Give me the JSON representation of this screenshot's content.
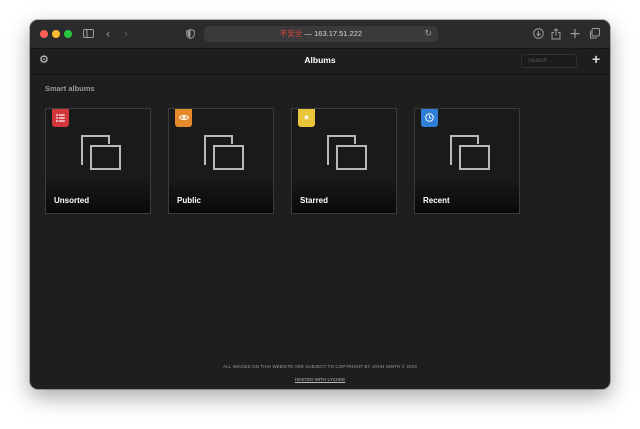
{
  "browser": {
    "url_warning": "不安全",
    "url_separator": "—",
    "url_host": "163.17.51.222",
    "icons": {
      "sidebar": "sidebar-icon",
      "back": "chevron-left-icon",
      "forward": "chevron-right-icon",
      "privacy": "shield-icon",
      "reload": "reload-icon",
      "download": "download-icon",
      "share": "share-icon",
      "new_tab": "plus-icon",
      "tabs": "tab-overview-icon"
    },
    "traffic_colors": [
      "#fe5f57",
      "#febc2e",
      "#28c840"
    ]
  },
  "header": {
    "title": "Albums",
    "search_placeholder": "Search …",
    "settings_icon": "gear-icon",
    "add_icon": "plus-icon"
  },
  "smart_albums": {
    "heading": "Smart albums",
    "items": [
      {
        "label": "Unsorted",
        "icon": "list-icon",
        "color": "#d0363a"
      },
      {
        "label": "Public",
        "icon": "eye-icon",
        "color": "#e58a2a"
      },
      {
        "label": "Starred",
        "icon": "star-icon",
        "color": "#e8c53a"
      },
      {
        "label": "Recent",
        "icon": "clock-icon",
        "color": "#2f7fd6"
      }
    ]
  },
  "footer": {
    "copyright": "ALL IMAGES ON THIS WEBSITE ARE SUBJECT TO COPYRIGHT BY JOHN SMITH © 2019",
    "hosted": "HOSTED WITH LYCHEE"
  }
}
